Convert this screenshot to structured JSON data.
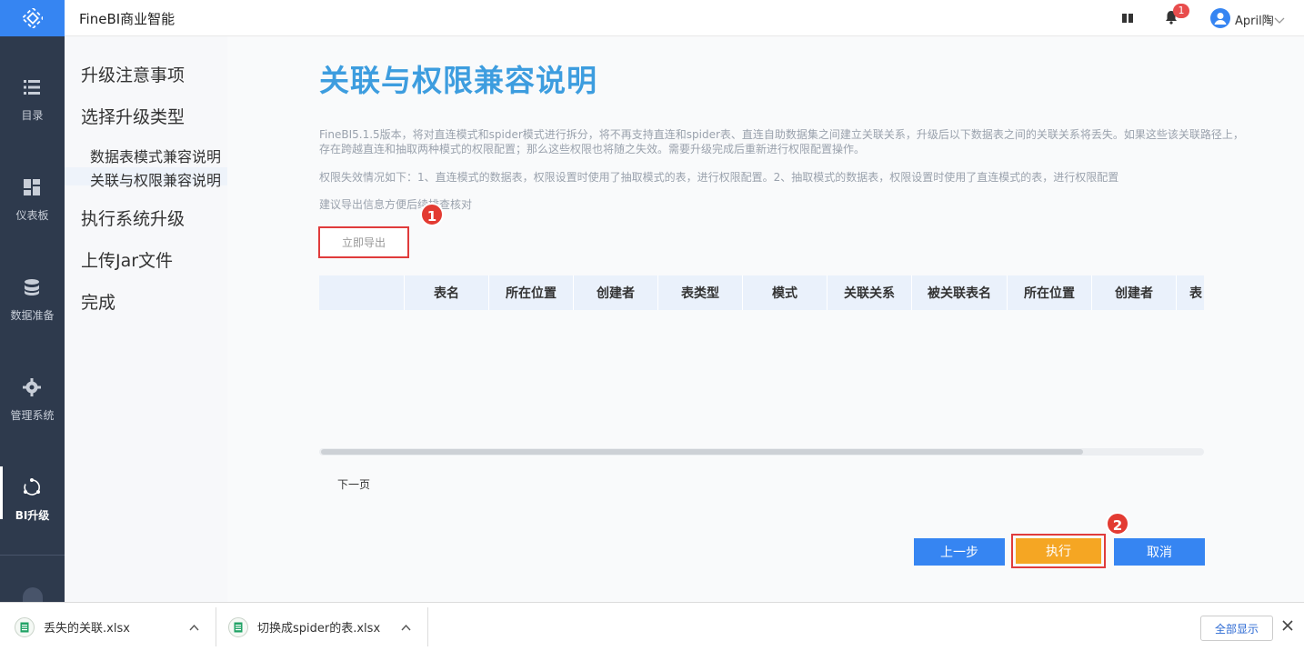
{
  "app": {
    "title": "FineBI商业智能"
  },
  "header": {
    "notification_count": "1",
    "user_name": "April陶"
  },
  "nav": {
    "items": [
      {
        "label": "目录",
        "icon": "list-icon"
      },
      {
        "label": "仪表板",
        "icon": "dashboard-icon"
      },
      {
        "label": "数据准备",
        "icon": "database-icon"
      },
      {
        "label": "管理系统",
        "icon": "gear-icon"
      },
      {
        "label": "BI升级",
        "icon": "upgrade-icon",
        "active": true
      }
    ]
  },
  "steps": {
    "s1": "升级注意事项",
    "s2": "选择升级类型",
    "s2a": "数据表模式兼容说明",
    "s2b": "关联与权限兼容说明",
    "s3": "执行系统升级",
    "s4": "上传Jar文件",
    "s5": "完成"
  },
  "main": {
    "heading": "关联与权限兼容说明",
    "para1": "FineBI5.1.5版本，将对直连模式和spider模式进行拆分，将不再支持直连和spider表、直连自助数据集之间建立关联关系，升级后以下数据表之间的关联关系将丢失。如果这些该关联路径上，存在跨越直连和抽取两种模式的权限配置；那么这些权限也将随之失效。需要升级完成后重新进行权限配置操作。",
    "para2": "权限失效情况如下：1、直连模式的数据表，权限设置时使用了抽取模式的表，进行权限配置。2、抽取模式的数据表，权限设置时使用了直连模式的表，进行权限配置",
    "para3": "建议导出信息方便后续排查核对",
    "export_button": "立即导出",
    "marker1": "1",
    "marker2": "2",
    "table_columns": [
      "",
      "表名",
      "所在位置",
      "创建者",
      "表类型",
      "模式",
      "关联关系",
      "被关联表名",
      "所在位置",
      "创建者",
      "表"
    ],
    "next_page": "下一页",
    "prev_button": "上一步",
    "execute_button": "执行",
    "cancel_button": "取消"
  },
  "downloads": {
    "file1": "丢失的关联.xlsx",
    "file2": "切换成spider的表.xlsx",
    "show_all": "全部显示"
  }
}
